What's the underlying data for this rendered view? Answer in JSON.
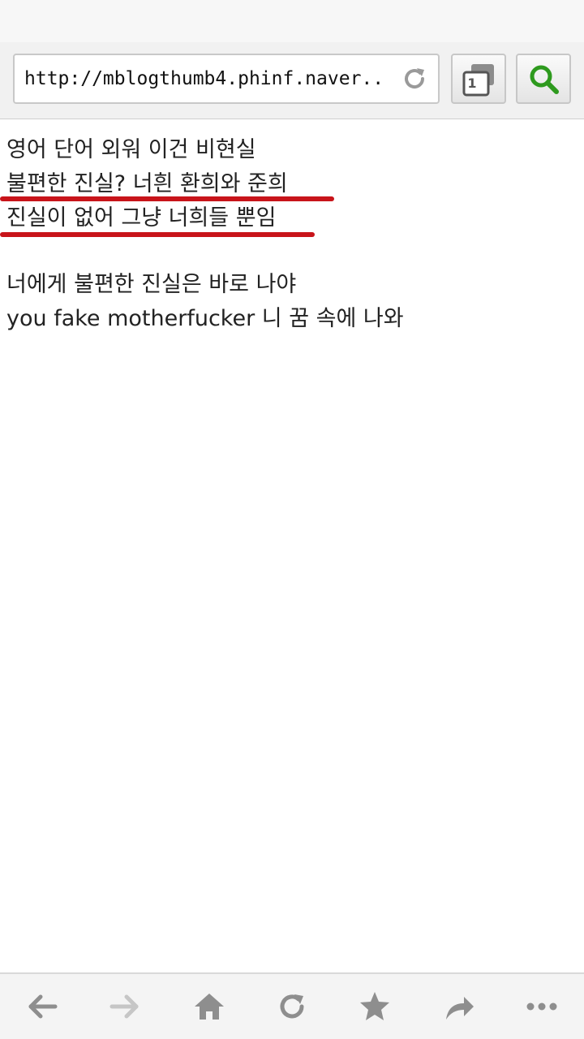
{
  "browser": {
    "url": "http://mblogthumb4.phinf.naver....",
    "tab_count": "1",
    "icons": {
      "reload": "reload-icon",
      "tabs": "tabs-icon",
      "search": "search-icon"
    },
    "accent_color": "#2e9a1e"
  },
  "content": {
    "lines": [
      "영어 단어 외워 이건 비현실",
      "불편한 진실? 너흰 환희와 준희",
      "진실이 없어 그냥 너희들 뿐임",
      "너에게 불편한 진실은 바로 나야",
      "you fake motherfucker 니 꿈 속에 나와"
    ],
    "highlight_color": "#c8141a"
  },
  "bottom_nav": {
    "items": [
      "back-icon",
      "forward-icon",
      "home-icon",
      "refresh-icon",
      "bookmark-star-icon",
      "share-icon",
      "more-icon"
    ]
  }
}
